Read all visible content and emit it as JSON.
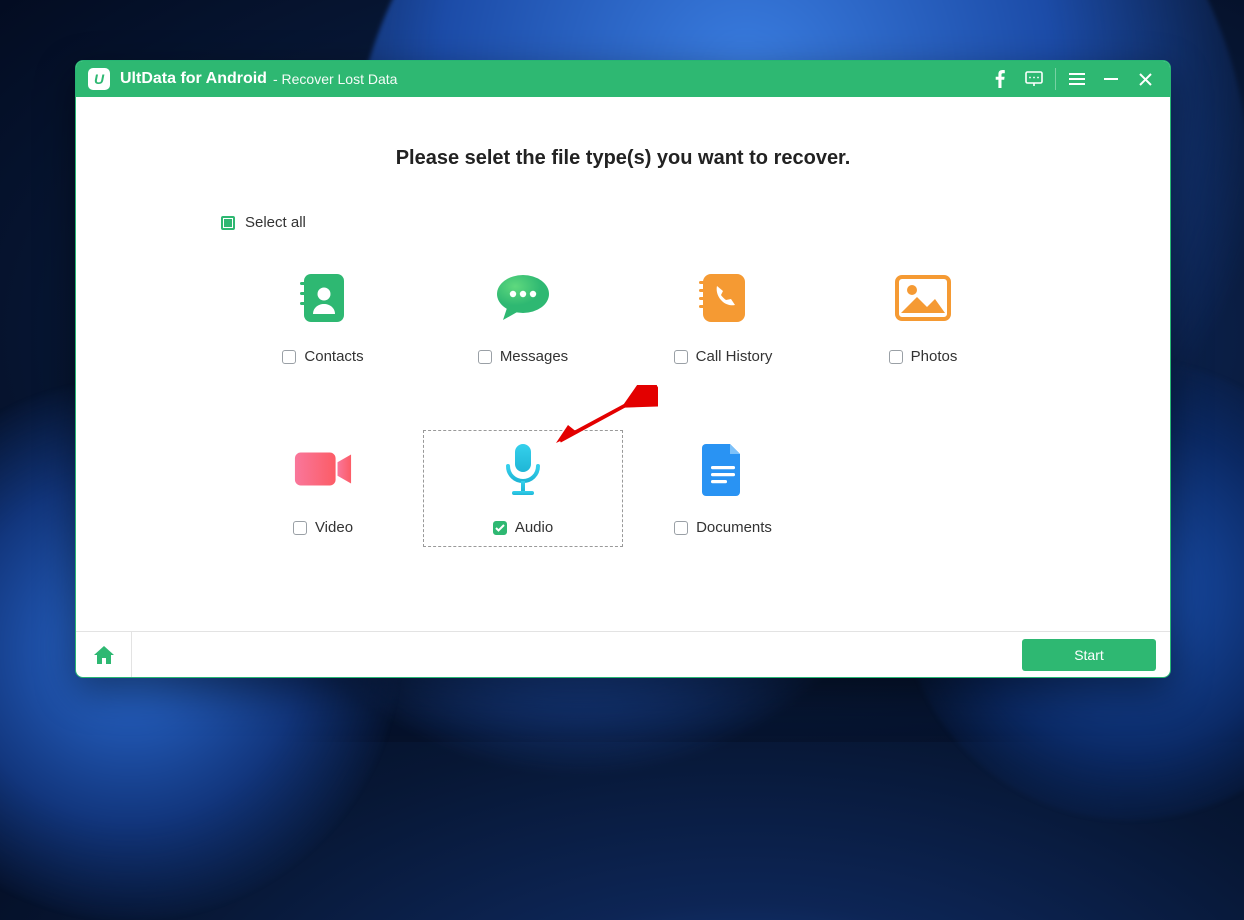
{
  "titlebar": {
    "app_name": "UltData for Android",
    "subtitle": "- Recover Lost Data"
  },
  "heading": "Please selet the file type(s) you want to recover.",
  "select_all_label": "Select all",
  "items": {
    "contacts": {
      "label": "Contacts",
      "checked": false
    },
    "messages": {
      "label": "Messages",
      "checked": false
    },
    "call_history": {
      "label": "Call History",
      "checked": false
    },
    "photos": {
      "label": "Photos",
      "checked": false
    },
    "video": {
      "label": "Video",
      "checked": false
    },
    "audio": {
      "label": "Audio",
      "checked": true
    },
    "documents": {
      "label": "Documents",
      "checked": false
    }
  },
  "footer": {
    "start_label": "Start"
  },
  "colors": {
    "accent": "#2eb872",
    "orange": "#f59a33",
    "blue": "#2993f3",
    "pink_start": "#f9779b",
    "pink_end": "#fc5c66"
  }
}
